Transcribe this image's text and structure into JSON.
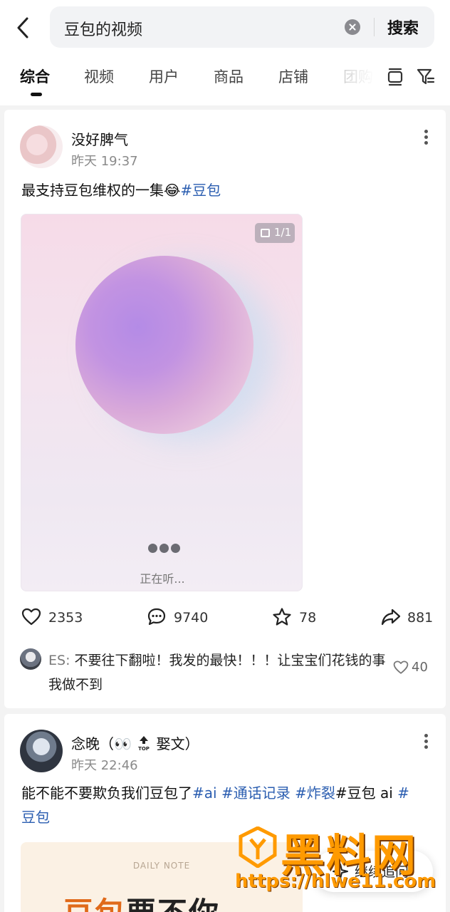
{
  "search": {
    "query": "豆包的视频",
    "button_label": "搜索"
  },
  "tabs": [
    {
      "label": "综合"
    },
    {
      "label": "视频"
    },
    {
      "label": "用户"
    },
    {
      "label": "商品"
    },
    {
      "label": "店铺"
    },
    {
      "label": "团购"
    }
  ],
  "posts": [
    {
      "username": "没好脾气",
      "timestamp": "昨天 19:37",
      "text": "最支持豆包维权的一集😂",
      "hashtag": "#豆包",
      "media": {
        "page_badge": "1/1",
        "listening_text": "正在听..."
      },
      "likes": "2353",
      "comments": "9740",
      "stars": "78",
      "shares": "881",
      "top_comment": {
        "author": "ES:",
        "text": "不要往下翻啦！我发的最快！！！让宝宝们花钱的事我做不到",
        "likes": "40"
      }
    },
    {
      "username": "念晚（👀",
      "username_suffix": "娶文）",
      "timestamp": "昨天 22:46",
      "text_prefix": "能不能不要欺负我们豆包了",
      "tags": [
        "#ai",
        "#通话记录",
        "#炸裂"
      ],
      "text_middle": "#豆包 ai",
      "tag_last": "#",
      "text_line2": "豆包",
      "preview": {
        "note_label": "DAILY NOTE",
        "title_accent": "豆包",
        "title_rest": "要不你"
      }
    }
  ],
  "floating": {
    "continue_label": "继续追问"
  },
  "watermark": {
    "title": "黑料网",
    "url": "https://hlwe11.com"
  },
  "colors": {
    "hashtag": "#2a5db0",
    "watermark": "#ff9a00",
    "background": "#f3f3f3"
  }
}
